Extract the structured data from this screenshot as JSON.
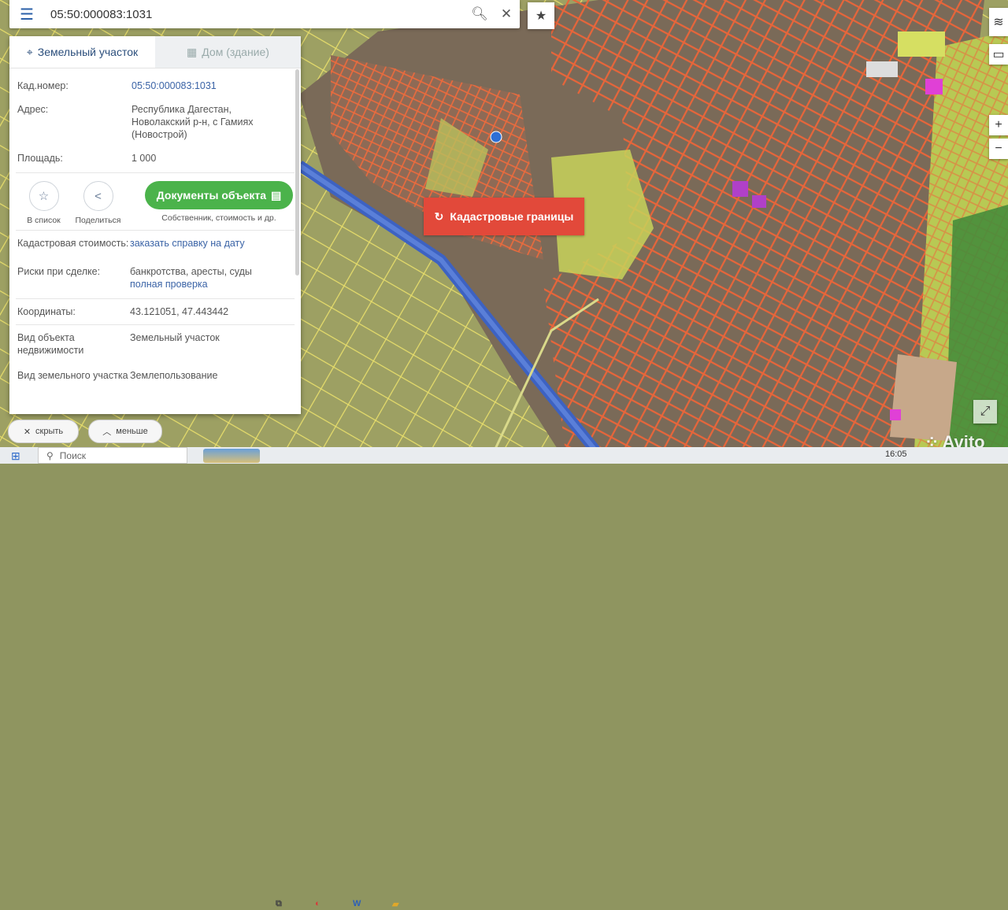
{
  "search": {
    "value": "05:50:000083:1031"
  },
  "tabs": [
    {
      "label": "Земельный участок"
    },
    {
      "label": "Дом (здание)"
    }
  ],
  "info": {
    "cad_label": "Кад.номер:",
    "cad_value": "05:50:000083:1031",
    "address_label": "Адрес:",
    "address_value": "Республика Дагестан, Новолакский р-н, с Гамиях (Новострой)",
    "area_label": "Площадь:",
    "area_value": "1 000"
  },
  "actions": {
    "list_label": "В список",
    "share_label": "Поделиться",
    "docs_label": "Документы объекта",
    "docs_sub": "Собственник, стоимость и др."
  },
  "details": {
    "cost_label": "Кадастровая стоимость:",
    "cost_link": "заказать справку на дату",
    "risk_label": "Риски при сделке:",
    "risk_value": "банкротства, аресты, суды",
    "risk_link": "полная проверка",
    "coords_label": "Координаты:",
    "coords_value": "43.121051, 47.443442",
    "objtype_label": "Вид объекта недвижимости",
    "objtype_value": "Земельный участок",
    "landtype_label": "Вид земельного участка",
    "landtype_value": "Землепользование"
  },
  "map": {
    "cadastral_button": "Кадастровые границы"
  },
  "bottom": {
    "hide_label": "скрыть",
    "less_label": "меньше"
  },
  "taskbar": {
    "search_placeholder": "Поиск",
    "time": "16:05"
  },
  "watermark": {
    "text": "Avito"
  },
  "colors": {
    "accent": "#3a63a6",
    "docs_green": "#4bb34b",
    "cadastral_red": "#e2493a",
    "parcel_line": "#e8653a"
  }
}
